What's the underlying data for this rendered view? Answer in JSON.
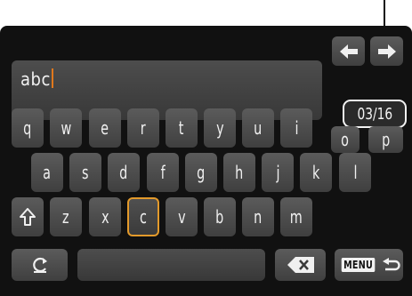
{
  "input": {
    "text": "abc"
  },
  "counter": "03/16",
  "nav": {
    "left_icon": "arrow-left-icon",
    "right_icon": "arrow-right-icon"
  },
  "keyboard": {
    "row1": [
      "q",
      "w",
      "e",
      "r",
      "t",
      "y",
      "u",
      "i",
      "o",
      "p"
    ],
    "row2": [
      "a",
      "s",
      "d",
      "f",
      "g",
      "h",
      "j",
      "k",
      "l"
    ],
    "row3": [
      "z",
      "x",
      "c",
      "v",
      "b",
      "n",
      "m"
    ],
    "selected_key": "c"
  },
  "bottom": {
    "menu_label": "MENU",
    "shift_icon": "shift-icon",
    "mode_icon": "mode-switch-icon",
    "delete_icon": "backspace-icon",
    "return_icon": "return-icon"
  },
  "colors": {
    "selection": "#e39a2b",
    "cursor": "#e0781c",
    "key": "#4a4a4a",
    "background": "#111111"
  }
}
